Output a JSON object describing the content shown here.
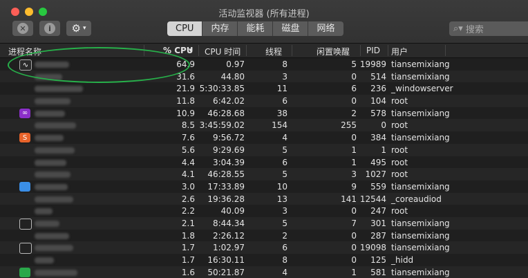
{
  "window": {
    "title": "活动监视器 (所有进程)"
  },
  "toolbar": {
    "stop_icon": "stop-process-icon",
    "info_icon": "info-icon",
    "gear_icon": "gear-icon",
    "tabs": [
      {
        "label": "CPU",
        "active": true
      },
      {
        "label": "内存"
      },
      {
        "label": "能耗"
      },
      {
        "label": "磁盘"
      },
      {
        "label": "网络"
      }
    ],
    "search_placeholder": "搜索"
  },
  "columns": {
    "name": "进程名称",
    "cpu": "% CPU",
    "cpu_time": "CPU 时间",
    "threads": "线程",
    "idle_wake": "闲置唤醒",
    "pid": "PID",
    "user": "用户"
  },
  "colors": {
    "accent_green": "#27b04a",
    "tab_active": "#d4d4d4"
  },
  "rows": [
    {
      "cpu": "64.9",
      "time": "0.97",
      "threads": "8",
      "wake": "5",
      "pid": "19989",
      "user": "tiansemixiang",
      "icon": "monitor"
    },
    {
      "cpu": "31.6",
      "time": "44.80",
      "threads": "3",
      "wake": "0",
      "pid": "514",
      "user": "tiansemixiang",
      "icon": ""
    },
    {
      "cpu": "21.9",
      "time": "5:30:33.85",
      "threads": "11",
      "wake": "6",
      "pid": "236",
      "user": "_windowserver",
      "icon": ""
    },
    {
      "cpu": "11.8",
      "time": "6:42.02",
      "threads": "6",
      "wake": "0",
      "pid": "104",
      "user": "root",
      "icon": ""
    },
    {
      "cpu": "10.9",
      "time": "46:28.68",
      "threads": "38",
      "wake": "2",
      "pid": "578",
      "user": "tiansemixiang",
      "icon": "purple"
    },
    {
      "cpu": "8.5",
      "time": "3:45:59.02",
      "threads": "154",
      "wake": "255",
      "pid": "0",
      "user": "root",
      "icon": ""
    },
    {
      "cpu": "7.6",
      "time": "9:56.72",
      "threads": "4",
      "wake": "0",
      "pid": "384",
      "user": "tiansemixiang",
      "icon": "orange"
    },
    {
      "cpu": "5.6",
      "time": "9:29.69",
      "threads": "5",
      "wake": "1",
      "pid": "1",
      "user": "root",
      "icon": ""
    },
    {
      "cpu": "4.4",
      "time": "3:04.39",
      "threads": "6",
      "wake": "1",
      "pid": "495",
      "user": "root",
      "icon": ""
    },
    {
      "cpu": "4.1",
      "time": "46:28.55",
      "threads": "5",
      "wake": "3",
      "pid": "1027",
      "user": "root",
      "icon": ""
    },
    {
      "cpu": "3.0",
      "time": "17:33.89",
      "threads": "10",
      "wake": "9",
      "pid": "559",
      "user": "tiansemixiang",
      "icon": "blue"
    },
    {
      "cpu": "2.6",
      "time": "19:36.28",
      "threads": "13",
      "wake": "141",
      "pid": "12544",
      "user": "_coreaudiod",
      "icon": ""
    },
    {
      "cpu": "2.2",
      "time": "40.09",
      "threads": "3",
      "wake": "0",
      "pid": "247",
      "user": "root",
      "icon": ""
    },
    {
      "cpu": "2.1",
      "time": "8:44.34",
      "threads": "5",
      "wake": "7",
      "pid": "301",
      "user": "tiansemixiang",
      "icon": "screen"
    },
    {
      "cpu": "1.8",
      "time": "2:26.12",
      "threads": "2",
      "wake": "0",
      "pid": "287",
      "user": "tiansemixiang",
      "icon": ""
    },
    {
      "cpu": "1.7",
      "time": "1:02.97",
      "threads": "6",
      "wake": "0",
      "pid": "19098",
      "user": "tiansemixiang",
      "icon": "screen"
    },
    {
      "cpu": "1.7",
      "time": "16:30.11",
      "threads": "8",
      "wake": "0",
      "pid": "125",
      "user": "_hidd",
      "icon": ""
    },
    {
      "cpu": "1.6",
      "time": "50:21.87",
      "threads": "4",
      "wake": "1",
      "pid": "581",
      "user": "tiansemixiang",
      "icon": "green"
    }
  ]
}
